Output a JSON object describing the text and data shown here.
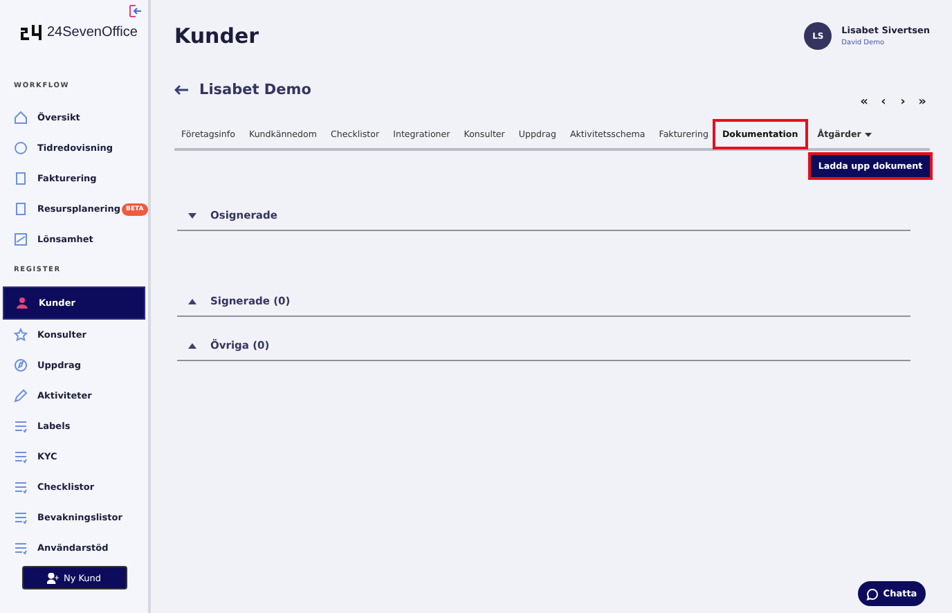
{
  "sidebar": {
    "logo": "24SevenOffice",
    "groups": [
      {
        "heading": "WORKFLOW",
        "items": [
          {
            "label": "Översikt",
            "selected": false
          },
          {
            "label": "Tidredovisning",
            "selected": false
          },
          {
            "label": "Fakturering",
            "selected": false
          },
          {
            "label": "Resursplanering",
            "selected": false,
            "badge": "BETA"
          },
          {
            "label": "Lönsamhet",
            "selected": false
          }
        ]
      },
      {
        "heading": "REGISTER",
        "items": [
          {
            "label": "Kunder",
            "selected": true
          },
          {
            "label": "Konsulter",
            "selected": false
          },
          {
            "label": "Uppdrag",
            "selected": false
          },
          {
            "label": "Aktiviteter",
            "selected": false
          },
          {
            "label": "Labels",
            "selected": false
          },
          {
            "label": "KYC",
            "selected": false
          },
          {
            "label": "Checklistor",
            "selected": false
          },
          {
            "label": "Bevakningslistor",
            "selected": false
          },
          {
            "label": "Användarstöd",
            "selected": false
          }
        ]
      }
    ],
    "new_button": "Ny Kund"
  },
  "header": {
    "title": "Kunder",
    "user": {
      "initials": "LS",
      "name": "Lisabet Sivertsen",
      "company": "David Demo"
    }
  },
  "record": {
    "title": "Lisabet Demo",
    "pager": [
      "«",
      "‹",
      "›",
      "»"
    ]
  },
  "tabs": [
    {
      "label": "Företagsinfo",
      "selected": false,
      "highlighted": false
    },
    {
      "label": "Kundkännedom",
      "selected": false,
      "highlighted": false
    },
    {
      "label": "Checklistor",
      "selected": false,
      "highlighted": false
    },
    {
      "label": "Integrationer",
      "selected": false,
      "highlighted": false
    },
    {
      "label": "Konsulter",
      "selected": false,
      "highlighted": false
    },
    {
      "label": "Uppdrag",
      "selected": false,
      "highlighted": false
    },
    {
      "label": "Aktivitetsschema",
      "selected": false,
      "highlighted": false
    },
    {
      "label": "Fakturering",
      "selected": false,
      "highlighted": false
    },
    {
      "label": "Dokumentation",
      "selected": true,
      "highlighted": true
    }
  ],
  "actions_menu": "Åtgärder",
  "upload_button": {
    "label": "Ladda upp dokument",
    "highlighted": true
  },
  "sections": [
    {
      "title": "Osignerade",
      "expanded": true
    },
    {
      "title": "Signerade (0)",
      "expanded": false
    },
    {
      "title": "Övriga (0)",
      "expanded": false
    }
  ],
  "chat_button": "Chatta"
}
